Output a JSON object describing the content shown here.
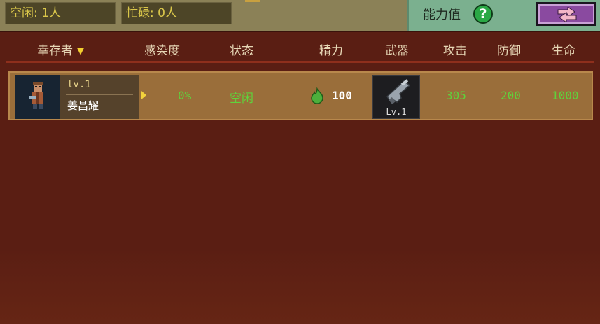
{
  "top_bar": {
    "idle_label": "空闲: 1人",
    "busy_label": "忙碌: 0人",
    "ability_label": "能力值",
    "help_glyph": "?"
  },
  "table": {
    "headers": {
      "survivor": "幸存者",
      "infection": "感染度",
      "status": "状态",
      "stamina": "精力",
      "weapon": "武器",
      "attack": "攻击",
      "defense": "防御",
      "health": "生命"
    },
    "rows": [
      {
        "level": "lv.1",
        "name": "姜昌耀",
        "infection": "0%",
        "status": "空闲",
        "stamina": "100",
        "weapon_level": "Lv.1",
        "attack": "305",
        "defense": "200",
        "health": "1000"
      }
    ]
  },
  "colors": {
    "panel_bg": "#5a1e13",
    "row_bg": "#9a6e3a",
    "stat_green": "#5fd23c",
    "ability_bg": "#7bb08f",
    "swap_button": "#8a4aa0"
  },
  "icons": {
    "sort": "chevron-down-icon",
    "help": "question-circle-icon",
    "swap": "swap-arrows-icon",
    "stamina": "green-blob-icon",
    "weapon": "pistol-icon",
    "expand": "play-triangle-icon"
  }
}
